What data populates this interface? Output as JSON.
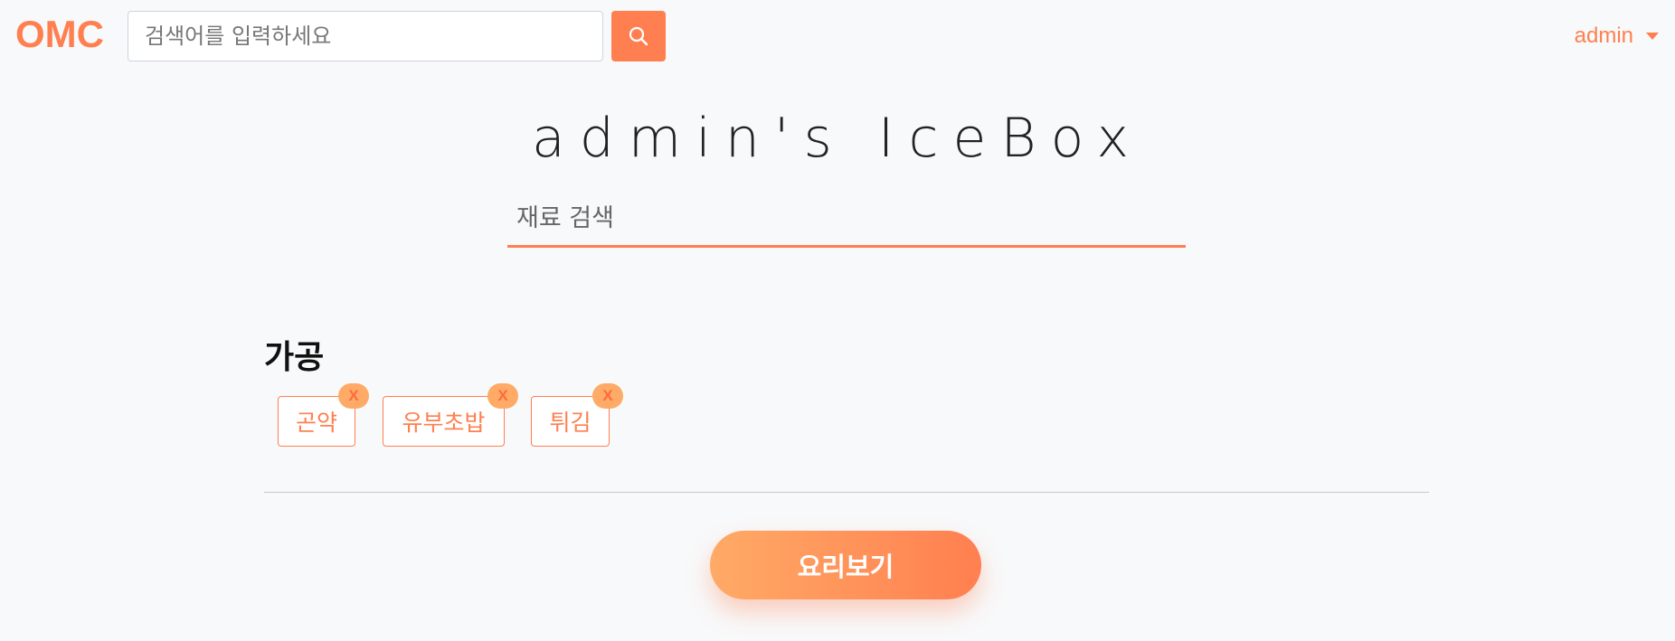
{
  "navbar": {
    "brand": "OMC",
    "search_placeholder": "검색어를 입력하세요",
    "user": "admin"
  },
  "main": {
    "title": "admin's IceBox",
    "ingredient_search_placeholder": "재료 검색",
    "categories": [
      {
        "name": "가공",
        "tags": [
          {
            "label": "곤약",
            "remove": "X"
          },
          {
            "label": "유부초밥",
            "remove": "X"
          },
          {
            "label": "튀김",
            "remove": "X"
          }
        ]
      }
    ],
    "cook_button": "요리보기"
  },
  "colors": {
    "accent": "#ff7f50",
    "accent_light": "#ffaa66",
    "background": "#f8f9fa"
  },
  "icons": {
    "search_button": "search-icon",
    "user_menu": "caret-down-icon"
  }
}
